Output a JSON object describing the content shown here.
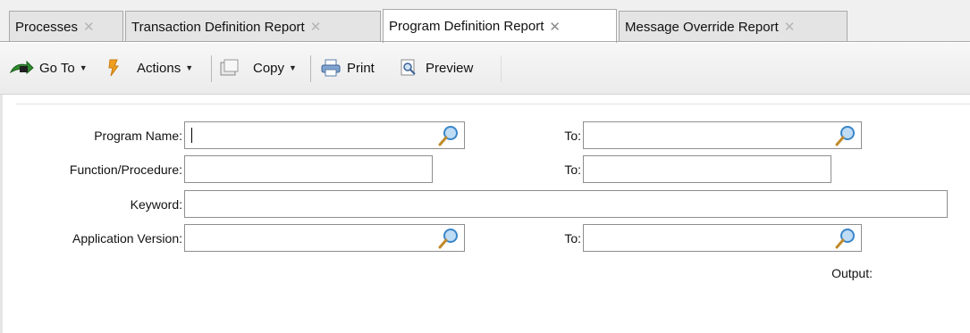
{
  "tabs": [
    {
      "label": "Processes",
      "active": false
    },
    {
      "label": "Transaction Definition Report",
      "active": false
    },
    {
      "label": "Program Definition Report",
      "active": true
    },
    {
      "label": "Message Override Report",
      "active": false
    }
  ],
  "tab_close_glyph": "✕",
  "toolbar": {
    "goto_label": "Go To",
    "actions_label": "Actions",
    "copy_label": "Copy",
    "print_label": "Print",
    "preview_label": "Preview",
    "icons": [
      "goto-arrow-icon",
      "actions-lightning-icon",
      "copy-icon",
      "print-icon",
      "preview-icon"
    ]
  },
  "form": {
    "program_name_label": "Program Name:",
    "program_name_value": "",
    "program_name_to_label": "To:",
    "program_name_to_value": "",
    "function_label": "Function/Procedure:",
    "function_value": "",
    "function_to_label": "To:",
    "function_to_value": "",
    "keyword_label": "Keyword:",
    "keyword_value": "",
    "app_version_label": "Application Version:",
    "app_version_value": "",
    "app_version_to_label": "To:",
    "app_version_to_value": "",
    "output_label": "Output:"
  },
  "colors": {
    "lookup_blue": "#3a86c8",
    "goto_green": "#2e8b2e",
    "actions_orange": "#f0a020"
  }
}
